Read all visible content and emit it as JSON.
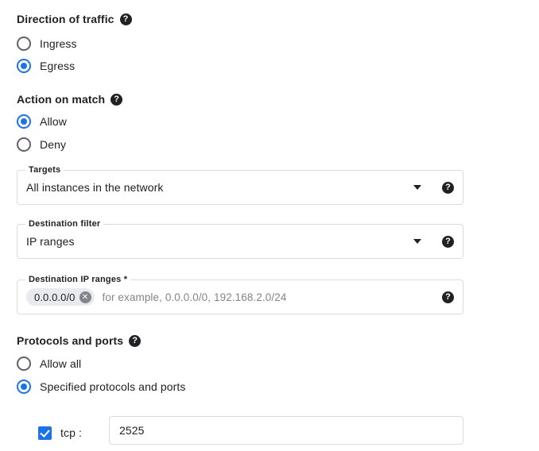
{
  "sections": {
    "direction": {
      "heading": "Direction of traffic",
      "help_icon": "help-circle-icon",
      "options": [
        {
          "label": "Ingress",
          "selected": false
        },
        {
          "label": "Egress",
          "selected": true
        }
      ]
    },
    "action": {
      "heading": "Action on match",
      "help_icon": "help-circle-icon",
      "options": [
        {
          "label": "Allow",
          "selected": true
        },
        {
          "label": "Deny",
          "selected": false
        }
      ]
    },
    "protocols": {
      "heading": "Protocols and ports",
      "help_icon": "help-circle-icon",
      "options": [
        {
          "label": "Allow all",
          "selected": false
        },
        {
          "label": "Specified protocols and ports",
          "selected": true
        }
      ]
    }
  },
  "fields": {
    "targets": {
      "label": "Targets",
      "value": "All instances in the network",
      "caret_icon": "chevron-down-icon",
      "help_icon": "help-circle-icon"
    },
    "destination_filter": {
      "label": "Destination filter",
      "value": "IP ranges",
      "caret_icon": "chevron-down-icon",
      "help_icon": "help-circle-icon"
    },
    "destination_ip_ranges": {
      "label": "Destination IP ranges *",
      "chips": [
        {
          "text": "0.0.0.0/0",
          "remove_icon": "close-circle-icon"
        }
      ],
      "placeholder": "for example, 0.0.0.0/0, 192.168.2.0/24",
      "help_icon": "help-circle-icon"
    }
  },
  "protocol_rows": [
    {
      "checked": true,
      "label": "tcp :",
      "port_value": "2525"
    }
  ],
  "glyphs": {
    "help": "?",
    "close": "✕"
  },
  "colors": {
    "accent": "#1a73e8",
    "text": "#202124",
    "muted": "#80868b",
    "border": "#dadce0",
    "chip_bg": "#e8eaed"
  }
}
